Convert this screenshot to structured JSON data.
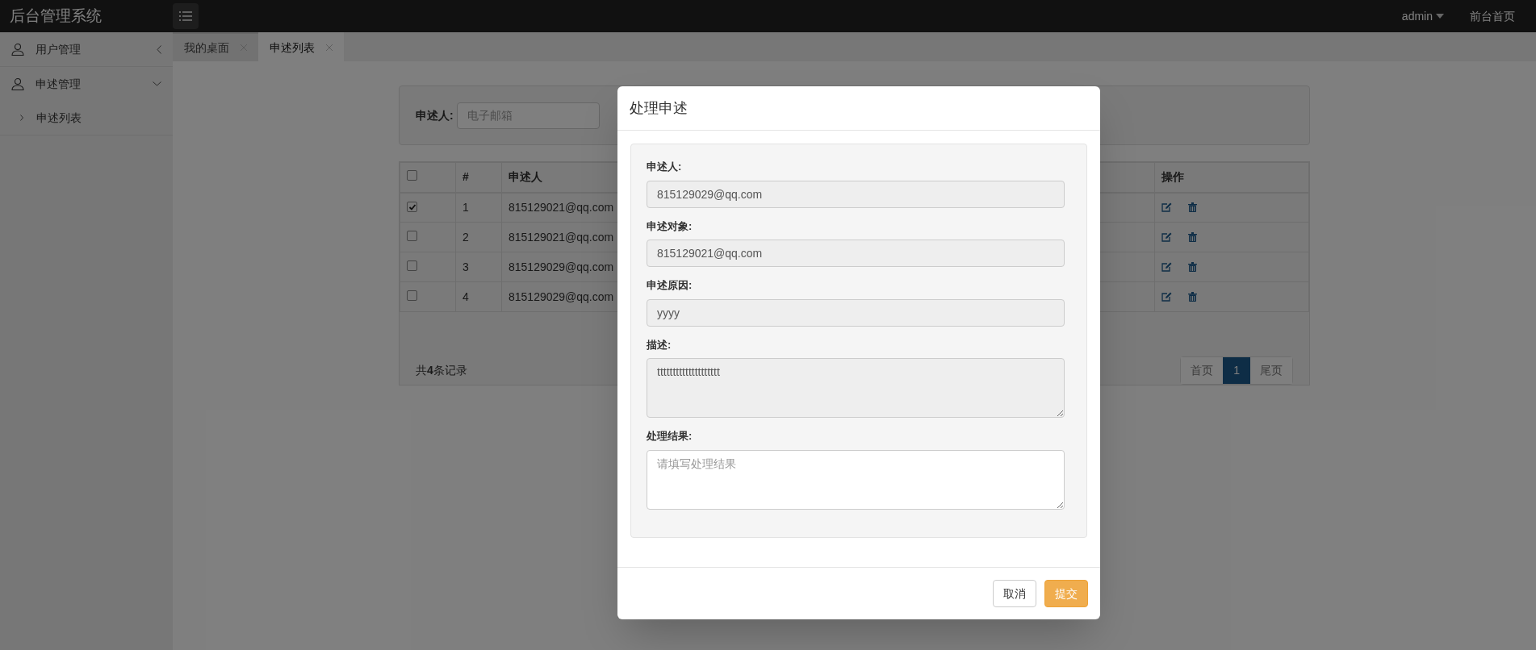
{
  "app_title": "后台管理系统",
  "topbar": {
    "user": "admin",
    "link": "前台首页"
  },
  "sidebar": {
    "items": [
      {
        "label": "用户管理",
        "expanded": false
      },
      {
        "label": "申述管理",
        "expanded": true,
        "children": [
          {
            "label": "申述列表"
          }
        ]
      }
    ]
  },
  "tabs": [
    {
      "label": "我的桌面",
      "selected": false
    },
    {
      "label": "申述列表",
      "selected": true
    }
  ],
  "filter": {
    "label": "申述人:",
    "placeholder": "电子邮箱"
  },
  "table": {
    "header_checked": false,
    "columns": [
      "#",
      "申述人",
      "操作"
    ],
    "rows": [
      {
        "checked": true,
        "index": "1",
        "complainant": "815129021@qq.com"
      },
      {
        "checked": false,
        "index": "2",
        "complainant": "815129021@qq.com"
      },
      {
        "checked": false,
        "index": "3",
        "complainant": "815129029@qq.com"
      },
      {
        "checked": false,
        "index": "4",
        "complainant": "815129029@qq.com"
      }
    ]
  },
  "record_count": "共**4**条记录",
  "pagination": [
    {
      "label": "首页",
      "selected": false
    },
    {
      "label": "1",
      "selected": true
    },
    {
      "label": "尾页",
      "selected": false
    }
  ],
  "modal": {
    "title": "处理申述",
    "fields": [
      {
        "label": "申述人:",
        "kind": "input",
        "value": "815129029@qq.com",
        "disabled": true
      },
      {
        "label": "申述对象:",
        "kind": "input",
        "value": "815129021@qq.com",
        "disabled": true
      },
      {
        "label": "申述原因:",
        "kind": "input",
        "value": "yyyy",
        "disabled": true
      },
      {
        "label": "描述:",
        "kind": "textarea",
        "value": "tttttttttttttttttttt",
        "disabled": true
      },
      {
        "label": "处理结果:",
        "kind": "textarea",
        "placeholder": "请填写处理结果",
        "disabled": false
      }
    ],
    "buttons": [
      {
        "label": "取消",
        "kind": "default"
      },
      {
        "label": "提交",
        "kind": "warning"
      }
    ]
  }
}
